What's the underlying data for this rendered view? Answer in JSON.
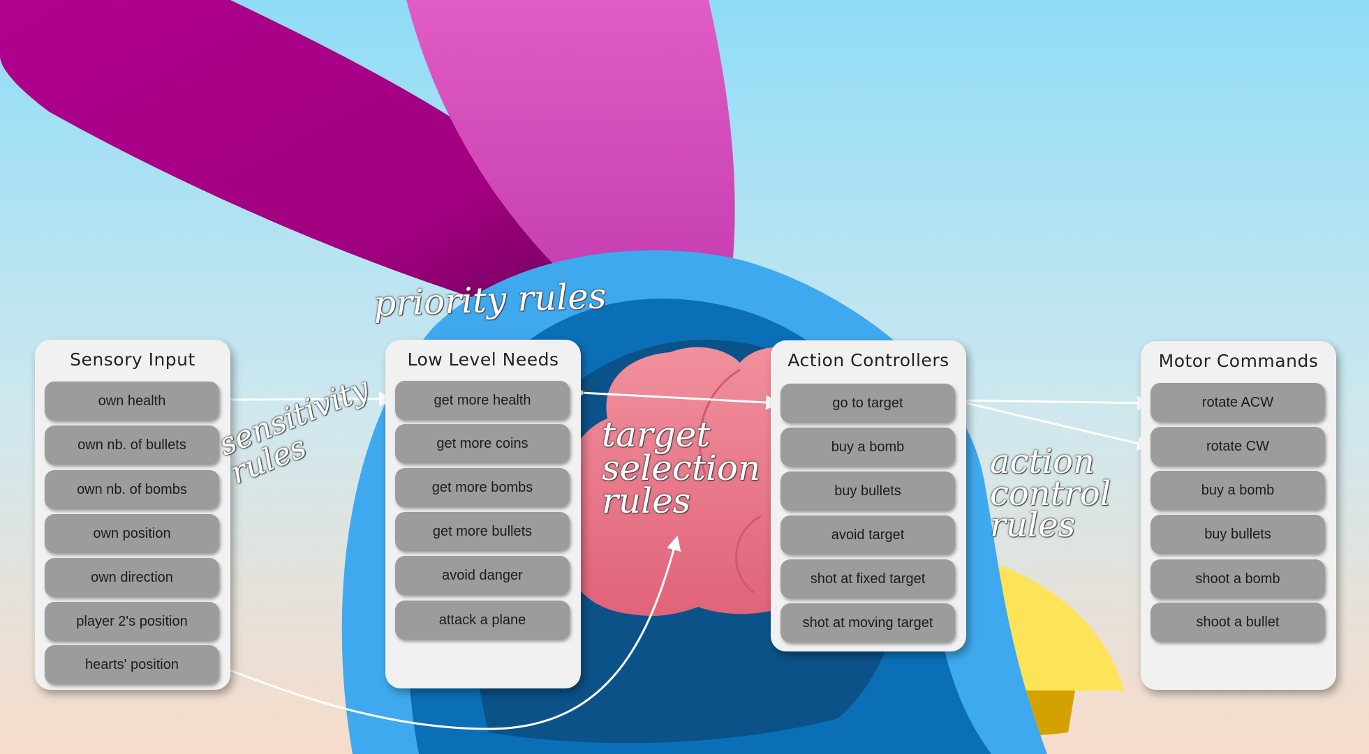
{
  "panels": {
    "sensory": {
      "title": "Sensory Input",
      "items": [
        "own health",
        "own nb. of bullets",
        "own nb. of bombs",
        "own position",
        "own direction",
        "player 2's position",
        "hearts' position"
      ]
    },
    "needs": {
      "title": "Low Level Needs",
      "items": [
        "get more health",
        "get more coins",
        "get more bombs",
        "get more bullets",
        "avoid danger",
        "attack a plane"
      ]
    },
    "actions": {
      "title": "Action Controllers",
      "items": [
        "go to target",
        "buy a bomb",
        "buy bullets",
        "avoid target",
        "shot at fixed target",
        "shot at moving target"
      ]
    },
    "motor": {
      "title": "Motor Commands",
      "items": [
        "rotate ACW",
        "rotate CW",
        "buy a bomb",
        "buy bullets",
        "shoot a bomb",
        "shoot a bullet"
      ]
    }
  },
  "annotations": {
    "priority": "priority rules",
    "sensitivity": "sensitivity\nrules",
    "target_selection": "target\nselection\nrules",
    "action_control": "action\ncontrol\nrules"
  },
  "colors": {
    "sky_top": "#8fdcf7",
    "sky_bottom": "#f7dcc9",
    "magenta": "#b0008f",
    "pink": "#e15cc4",
    "blue": "#3fa9ef",
    "navy": "#0b5289",
    "brain": "#ec7d8e",
    "yellow": "#fde357",
    "item": "#9c9c9c",
    "panel": "#f1f1f1"
  }
}
